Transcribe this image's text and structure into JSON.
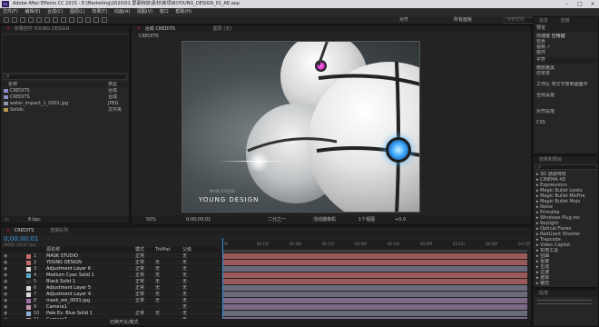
{
  "window": {
    "title": "Adobe After Effects CC 2015 - E:\\Marketing\\2020\\01 屏幕特效\\素材\\新项目\\YOUNG_DESIGN_01_AE.aep",
    "min": "–",
    "max": "□",
    "close": "×",
    "app_abbr": "Ae"
  },
  "menu": [
    "文件(F)",
    "编辑(E)",
    "合成(C)",
    "图层(L)",
    "效果(T)",
    "动画(A)",
    "视图(V)",
    "窗口",
    "帮助(H)"
  ],
  "toolbar": {
    "align_label": "对齐",
    "workspace_label": "所有面板",
    "search_placeholder": "搜索帮助"
  },
  "project": {
    "tab": "项目",
    "effect_tab": "效果控件 YOUNG DESIGN",
    "search_placeholder": "ρ",
    "col_name": "名称",
    "col_type": "类型",
    "items": [
      {
        "name": "CREDITS",
        "type": "合成"
      },
      {
        "name": "CREDITS",
        "type": "合成"
      },
      {
        "name": "water_impact_1_0001.jpg",
        "type": "JPEG"
      },
      {
        "name": "Solids",
        "type": "文件夹"
      }
    ],
    "bpc": "8 bpc"
  },
  "comp": {
    "tab": "合成 CREDITS",
    "layer_tab": "图层 (无)",
    "flow": "CREDITS",
    "controls": {
      "zoom": "50%",
      "time": "0;00;00;01",
      "res": "二分之一",
      "camera": "活动摄像机",
      "view": "1个视图",
      "offset": "+0.0"
    }
  },
  "viewer": {
    "logo_text": "YOUNG DESIGN",
    "logo_sub": "MASK STUDIO"
  },
  "info": {
    "tab": "信息",
    "audio_tab": "音频"
  },
  "preview": {
    "tab": "预览",
    "rows": [
      {
        "k": "快捷键",
        "v": "空格键"
      },
      {
        "k": "包含",
        "v": ""
      },
      {
        "k": "视频",
        "v": "✓"
      },
      {
        "k": "循环",
        "v": ""
      }
    ]
  },
  "character": {
    "tab": "字符",
    "rows": [
      "微软雅黑",
      "仿宋体",
      "",
      "工作区 将文字放到画面中",
      "",
      "全局设置",
      "",
      "",
      "对齐段落",
      "",
      "CSS"
    ]
  },
  "effects": {
    "tab": "效果和预设",
    "search_placeholder": "ρ",
    "items": [
      "3D 通道特效",
      "CINEMA 4D",
      "Expressions",
      "Magic Bullet Looks",
      "Magic Bullet MisFire",
      "Magic Bullet Mojo",
      "Noise",
      "Primatte",
      "Windows Plug-ins",
      "Keylight",
      "Optical Flares",
      "RedGiant Shooter",
      "Trapcode",
      "Video Copilot",
      "实用工具",
      "扭曲",
      "抠像",
      "生成",
      "过渡",
      "遮罩",
      "键控"
    ]
  },
  "paragraph": {
    "tab": "段落"
  },
  "timeline": {
    "tab": "CREDITS",
    "render_tab": "渲染队列",
    "timecode": "0;00;00;01",
    "fps": "00001 (29.97 fps)",
    "cols": {
      "name": "源名称",
      "mode": "模式",
      "trkmat": "TrkMat",
      "parent": "父级"
    },
    "layers": [
      {
        "n": "1",
        "name": "MASK STUDIO",
        "color": "#c86b6b",
        "mode": "正常",
        "trk": "",
        "parent": "无"
      },
      {
        "n": "2",
        "name": "YOUNG DESIGN",
        "color": "#c86b6b",
        "mode": "正常",
        "trk": "无",
        "parent": "无"
      },
      {
        "n": "3",
        "name": "Adjustment Layer 6",
        "color": "#d9d9d9",
        "mode": "正常",
        "trk": "无",
        "parent": "无"
      },
      {
        "n": "4",
        "name": "Medium Cyan Solid 1",
        "color": "#5ba9c4",
        "mode": "正常",
        "trk": "无",
        "parent": "无"
      },
      {
        "n": "5",
        "name": "Black Solid 1",
        "color": "#333",
        "mode": "正常",
        "trk": "无",
        "parent": "无"
      },
      {
        "n": "6",
        "name": "Adjustment Layer 5",
        "color": "#d9d9d9",
        "mode": "正常",
        "trk": "无",
        "parent": "无"
      },
      {
        "n": "7",
        "name": "Adjustment Layer 4",
        "color": "#d9d9d9",
        "mode": "正常",
        "trk": "无",
        "parent": "无"
      },
      {
        "n": "8",
        "name": "mask_ele_0001.jpg",
        "color": "#9f6fa8",
        "mode": "正常",
        "trk": "无",
        "parent": "无"
      },
      {
        "n": "9",
        "name": "Camera1",
        "color": "#c49ab0",
        "mode": "",
        "trk": "",
        "parent": "无"
      },
      {
        "n": "10",
        "name": "Pale Ex. Blue Solid 1",
        "color": "#8fb0d8",
        "mode": "正常",
        "trk": "无",
        "parent": "无"
      },
      {
        "n": "11",
        "name": "Camera2",
        "color": "#c49ab0",
        "mode": "",
        "trk": "",
        "parent": "无"
      }
    ],
    "ruler": [
      "0f",
      "00:15f",
      "01:00f",
      "01:15f",
      "02:00f",
      "02:15f",
      "03:00f",
      "03:15f",
      "04:00f",
      "04:15f"
    ],
    "footer": "切换开关/模式"
  },
  "colors": {
    "accent": "#4a90e2",
    "bar_red": "#9b5a5a",
    "bar_gray": "#6a6a7a",
    "bar_purple": "#7a6a86",
    "playhead": "#2f8fd8"
  }
}
